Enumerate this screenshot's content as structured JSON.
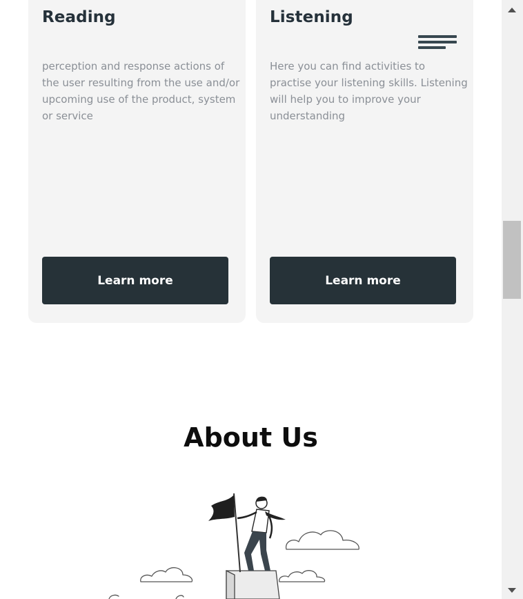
{
  "cards": [
    {
      "title": "Reading",
      "description": "perception and response actions of the user resulting from the use and/or upcoming use of the product, system or service",
      "button_label": "Learn more"
    },
    {
      "title": "Listening",
      "description": "Here you can find activities to practise your listening skills. Listening will help you to improve your understanding",
      "button_label": "Learn more"
    }
  ],
  "about": {
    "title": "About Us"
  },
  "icons": {
    "menu": "hamburger-menu-icon",
    "illustration": "man-with-flag-on-summit-illustration"
  },
  "colors": {
    "card_bg": "#f4f4f4",
    "button_bg": "#263238",
    "heading": "#25313a",
    "body_text": "#8a8f96"
  }
}
